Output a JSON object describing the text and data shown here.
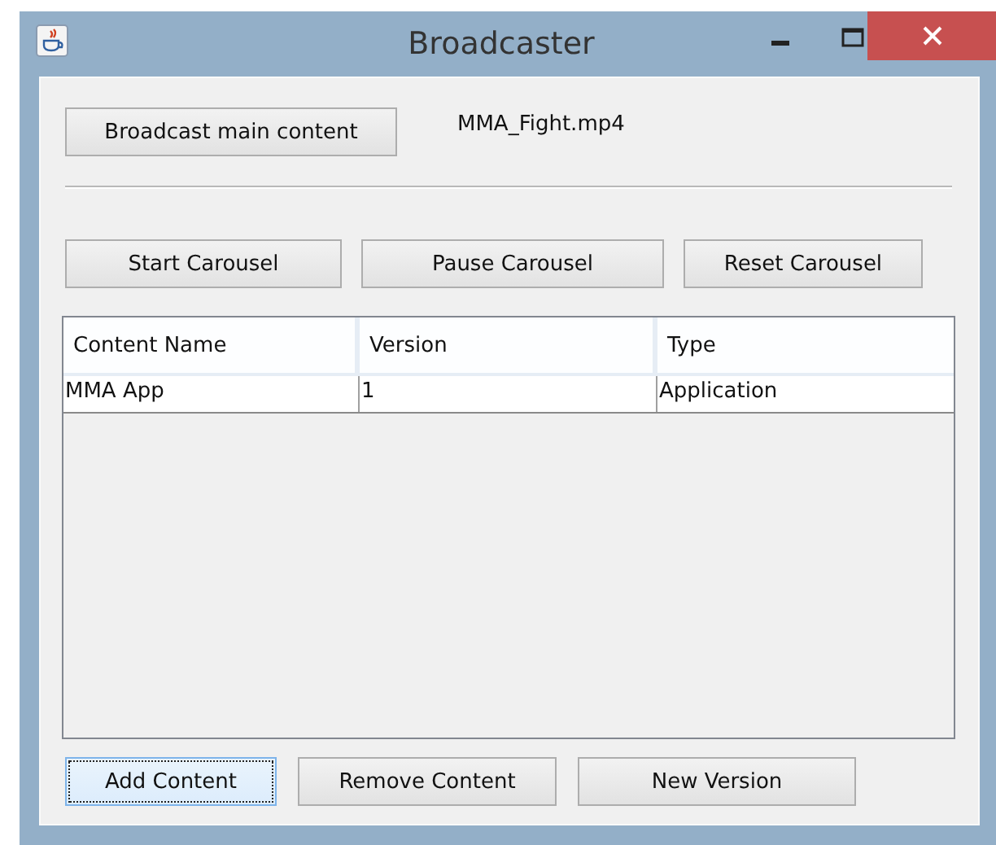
{
  "window": {
    "title": "Broadcaster"
  },
  "main": {
    "button": "Broadcast main content",
    "file": "MMA_Fight.mp4"
  },
  "carousel_buttons": [
    {
      "label": "Start Carousel",
      "focused": false
    },
    {
      "label": "Pause Carousel",
      "focused": false
    },
    {
      "label": "Reset Carousel",
      "focused": false
    }
  ],
  "table": {
    "columns": [
      "Content Name",
      "Version",
      "Type"
    ],
    "rows": [
      [
        "MMA App",
        "1",
        "Application"
      ]
    ]
  },
  "bottom_buttons": [
    {
      "label": "Add Content",
      "focused": true
    },
    {
      "label": "Remove Content",
      "focused": false
    },
    {
      "label": "New Version",
      "focused": false
    }
  ]
}
